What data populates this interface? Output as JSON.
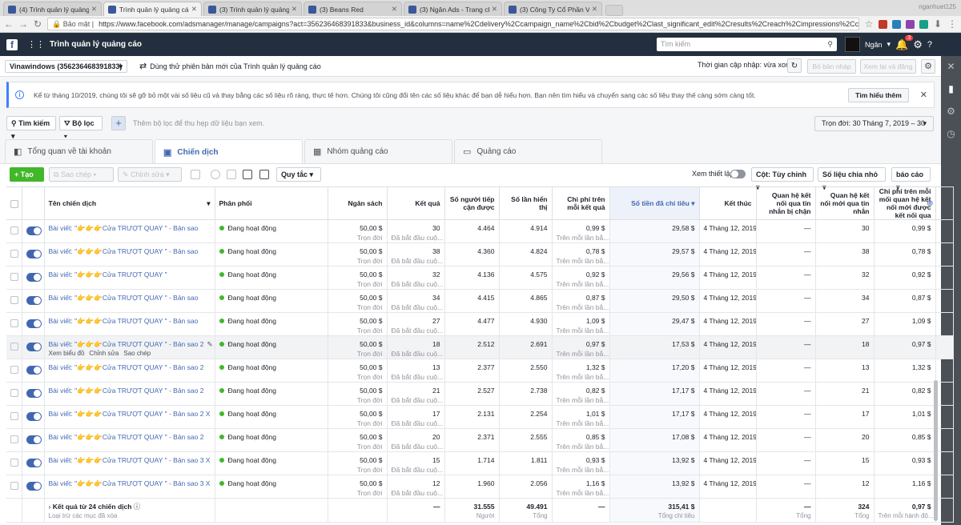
{
  "browser": {
    "tabs": [
      {
        "title": "(4) Trình quản lý quảng cá",
        "icon_color": "#3b5998",
        "active": false
      },
      {
        "title": "Trình quản lý quảng cáo",
        "icon_color": "#3b5998",
        "active": true
      },
      {
        "title": "(3) Trình quản lý quảng c",
        "icon_color": "#3b5998",
        "active": false
      },
      {
        "title": "(3) Beans Red",
        "icon_color": "#3b5998",
        "active": false
      },
      {
        "title": "(3) Ngân Ads - Trang chủ",
        "icon_color": "#3b5998",
        "active": false
      },
      {
        "title": "(3) Công Ty Cổ Phần VIN",
        "icon_color": "#3b5998",
        "active": false
      }
    ],
    "profile": "nganhuet125",
    "security": "Bảo mật",
    "url": "https://www.facebook.com/adsmanager/manage/campaigns?act=356236468391833&business_id&columns=name%2Cdelivery%2Ccampaign_name%2Cbid%2Cbudget%2Clast_significant_edit%2Cresults%2Creach%2Cimpressions%2Ccost_per_..."
  },
  "fb": {
    "app_title": "Trình quản lý quảng cáo",
    "search_placeholder": "Tìm kiếm",
    "user": "Ngân",
    "notif_count": "3"
  },
  "account": {
    "name": "Vinawindows (356236468391833)",
    "try_new": "Dùng thử phiên bản mới của Trình quản lý quảng cáo",
    "draft_status": "Thời gian cập nhập: vừa xong",
    "discard": "Bỏ bản nháp",
    "review": "Xem lại và đăng"
  },
  "notice": {
    "text": "Kể từ tháng 10/2019, chúng tôi sẽ gỡ bỏ một vài số liệu cũ và thay bằng các số liệu rõ ràng, thực tế hơn. Chúng tôi cũng đổi tên các số liệu khác để bạn dễ hiểu hơn. Bạn nên tìm hiểu và chuyển sang các số liệu thay thế càng sớm càng tốt.",
    "learn_more": "Tìm hiểu thêm"
  },
  "filters": {
    "search": "Tìm kiếm",
    "filter": "Bộ lọc",
    "hint": "Thêm bộ lọc để thu hẹp dữ liệu bạn xem.",
    "date_range": "Trọn đời: 30 Tháng 7, 2019 – 30"
  },
  "level_tabs": [
    "Tổng quan về tài khoản",
    "Chiến dịch",
    "Nhóm quảng cáo",
    "Quảng cáo"
  ],
  "toolbar": {
    "create": "Tạo",
    "copy": "Sao chép",
    "edit": "Chỉnh sửa",
    "rules": "Quy tắc",
    "view_setup": "Xem thiết lập",
    "columns": "Cột: Tùy chỉnh",
    "breakdown": "Số liệu chia nhỏ",
    "reports": "báo cáo"
  },
  "columns": [
    "Tên chiến dịch",
    "Phân phối",
    "Ngân sách",
    "Kết quả",
    "Số người tiếp cận được",
    "Số lần hiển thị",
    "Chi phí trên mỗi kết quả",
    "Số tiền đã chi tiêu",
    "Kết thúc",
    "Quan hệ kết nối qua tin nhắn bị chặn",
    "Quan hệ kết nối mới qua tin nhắn",
    "Chi phí trên mỗi mối quan hệ kết nối mới được kết nối qua"
  ],
  "rows": [
    {
      "name": "Bài viết: \"👉👉👉Cửa TRƯỢT QUAY \" - Bản sao",
      "delivery": "Đang hoạt động",
      "budget": "50,00 $",
      "budget_sub": "Trọn đời",
      "results": "30",
      "results_sub": "Đã bắt đầu cuộ...",
      "reach": "4.464",
      "impr": "4.914",
      "cpr": "0,99 $",
      "cpr_sub": "Trên mỗi lần bắ...",
      "spent": "29,58 $",
      "ends": "4 Tháng 12, 2019",
      "blocked": "—",
      "new_conn": "30",
      "cost_conn": "0,99 $"
    },
    {
      "name": "Bài viết: \"👉👉👉Cửa TRƯỢT QUAY \" - Bản sao",
      "delivery": "Đang hoạt động",
      "budget": "50,00 $",
      "budget_sub": "Trọn đời",
      "results": "38",
      "results_sub": "Đã bắt đầu cuộ...",
      "reach": "4.360",
      "impr": "4.824",
      "cpr": "0,78 $",
      "cpr_sub": "Trên mỗi lần bắ...",
      "spent": "29,57 $",
      "ends": "4 Tháng 12, 2019",
      "blocked": "—",
      "new_conn": "38",
      "cost_conn": "0,78 $"
    },
    {
      "name": "Bài viết: \"👉👉👉Cửa TRƯỢT QUAY \"",
      "delivery": "Đang hoạt động",
      "budget": "50,00 $",
      "budget_sub": "Trọn đời",
      "results": "32",
      "results_sub": "Đã bắt đầu cuộ...",
      "reach": "4.136",
      "impr": "4.575",
      "cpr": "0,92 $",
      "cpr_sub": "Trên mỗi lần bắ...",
      "spent": "29,56 $",
      "ends": "4 Tháng 12, 2019",
      "blocked": "—",
      "new_conn": "32",
      "cost_conn": "0,92 $"
    },
    {
      "name": "Bài viết: \"👉👉👉Cửa TRƯỢT QUAY \" - Bản sao",
      "delivery": "Đang hoạt động",
      "budget": "50,00 $",
      "budget_sub": "Trọn đời",
      "results": "34",
      "results_sub": "Đã bắt đầu cuộ...",
      "reach": "4.415",
      "impr": "4.865",
      "cpr": "0,87 $",
      "cpr_sub": "Trên mỗi lần bắ...",
      "spent": "29,50 $",
      "ends": "4 Tháng 12, 2019",
      "blocked": "—",
      "new_conn": "34",
      "cost_conn": "0,87 $"
    },
    {
      "name": "Bài viết: \"👉👉👉Cửa TRƯỢT QUAY \" - Bản sao",
      "delivery": "Đang hoạt động",
      "budget": "50,00 $",
      "budget_sub": "Trọn đời",
      "results": "27",
      "results_sub": "Đã bắt đầu cuộ...",
      "reach": "4.477",
      "impr": "4.930",
      "cpr": "1,09 $",
      "cpr_sub": "Trên mỗi lần bắ...",
      "spent": "29,47 $",
      "ends": "4 Tháng 12, 2019",
      "blocked": "—",
      "new_conn": "27",
      "cost_conn": "1,09 $"
    },
    {
      "name": "Bài viết: \"👉👉👉Cửa TRƯỢT QUAY \" - Bản sao 2",
      "delivery": "Đang hoạt động",
      "budget": "50,00 $",
      "budget_sub": "Trọn đời",
      "results": "18",
      "results_sub": "Đã bắt đầu cuộ...",
      "reach": "2.512",
      "impr": "2.691",
      "cpr": "0,97 $",
      "cpr_sub": "Trên mỗi lần bắ...",
      "spent": "17,53 $",
      "ends": "4 Tháng 12, 2019",
      "blocked": "—",
      "new_conn": "18",
      "cost_conn": "0,97 $"
    },
    {
      "name": "Bài viết: \"👉👉👉Cửa TRƯỢT QUAY \" - Bản sao 2",
      "delivery": "Đang hoạt động",
      "budget": "50,00 $",
      "budget_sub": "Trọn đời",
      "results": "13",
      "results_sub": "Đã bắt đầu cuộ...",
      "reach": "2.377",
      "impr": "2.550",
      "cpr": "1,32 $",
      "cpr_sub": "Trên mỗi lần bắ...",
      "spent": "17,20 $",
      "ends": "4 Tháng 12, 2019",
      "blocked": "—",
      "new_conn": "13",
      "cost_conn": "1,32 $"
    },
    {
      "name": "Bài viết: \"👉👉👉Cửa TRƯỢT QUAY \" - Bản sao 2",
      "delivery": "Đang hoạt động",
      "budget": "50,00 $",
      "budget_sub": "Trọn đời",
      "results": "21",
      "results_sub": "Đã bắt đầu cuộ...",
      "reach": "2.527",
      "impr": "2.738",
      "cpr": "0,82 $",
      "cpr_sub": "Trên mỗi lần bắ...",
      "spent": "17,17 $",
      "ends": "4 Tháng 12, 2019",
      "blocked": "—",
      "new_conn": "21",
      "cost_conn": "0,82 $"
    },
    {
      "name": "Bài viết: \"👉👉👉Cửa TRƯỢT QUAY \" - Bản sao 2 X",
      "delivery": "Đang hoạt động",
      "budget": "50,00 $",
      "budget_sub": "Trọn đời",
      "results": "17",
      "results_sub": "Đã bắt đầu cuộ...",
      "reach": "2.131",
      "impr": "2.254",
      "cpr": "1,01 $",
      "cpr_sub": "Trên mỗi lần bắ...",
      "spent": "17,17 $",
      "ends": "4 Tháng 12, 2019",
      "blocked": "—",
      "new_conn": "17",
      "cost_conn": "1,01 $"
    },
    {
      "name": "Bài viết: \"👉👉👉Cửa TRƯỢT QUAY \" - Bản sao 2",
      "delivery": "Đang hoạt động",
      "budget": "50,00 $",
      "budget_sub": "Trọn đời",
      "results": "20",
      "results_sub": "Đã bắt đầu cuộ...",
      "reach": "2.371",
      "impr": "2.555",
      "cpr": "0,85 $",
      "cpr_sub": "Trên mỗi lần bắ...",
      "spent": "17,08 $",
      "ends": "4 Tháng 12, 2019",
      "blocked": "—",
      "new_conn": "20",
      "cost_conn": "0,85 $"
    },
    {
      "name": "Bài viết: \"👉👉👉Cửa TRƯỢT QUAY \" - Bản sao 3 X",
      "delivery": "Đang hoạt động",
      "budget": "50,00 $",
      "budget_sub": "Trọn đời",
      "results": "15",
      "results_sub": "Đã bắt đầu cuộ...",
      "reach": "1.714",
      "impr": "1.811",
      "cpr": "0,93 $",
      "cpr_sub": "Trên mỗi lần bắ...",
      "spent": "13,92 $",
      "ends": "4 Tháng 12, 2019",
      "blocked": "—",
      "new_conn": "15",
      "cost_conn": "0,93 $"
    },
    {
      "name": "Bài viết: \"👉👉👉Cửa TRƯỢT QUAY \" - Bản sao 3 X",
      "delivery": "Đang hoạt động",
      "budget": "50,00 $",
      "budget_sub": "Trọn đời",
      "results": "12",
      "results_sub": "Đã bắt đầu cuộ...",
      "reach": "1.960",
      "impr": "2.056",
      "cpr": "1,16 $",
      "cpr_sub": "Trên mỗi lần bắ...",
      "spent": "13,92 $",
      "ends": "4 Tháng 12, 2019",
      "blocked": "—",
      "new_conn": "12",
      "cost_conn": "1,16 $"
    }
  ],
  "row_hover": {
    "view_chart": "Xem biểu đồ",
    "edit": "Chỉnh sửa",
    "duplicate": "Sao chép"
  },
  "totals": {
    "label": "Kết quả từ 24 chiến dịch",
    "sub": "Loại trừ các mục đã xóa",
    "results": "—",
    "reach": "31.555",
    "reach_sub": "Người",
    "impr": "49.491",
    "impr_sub": "Tổng",
    "cpr": "—",
    "spent": "315,41 $",
    "spent_sub": "Tổng chi tiêu",
    "blocked": "—",
    "blocked_sub": "Tổng",
    "new_conn": "324",
    "new_conn_sub": "Tổng",
    "cost_conn": "0,97 $",
    "cost_conn_sub": "Trên mỗi hành độ..."
  }
}
